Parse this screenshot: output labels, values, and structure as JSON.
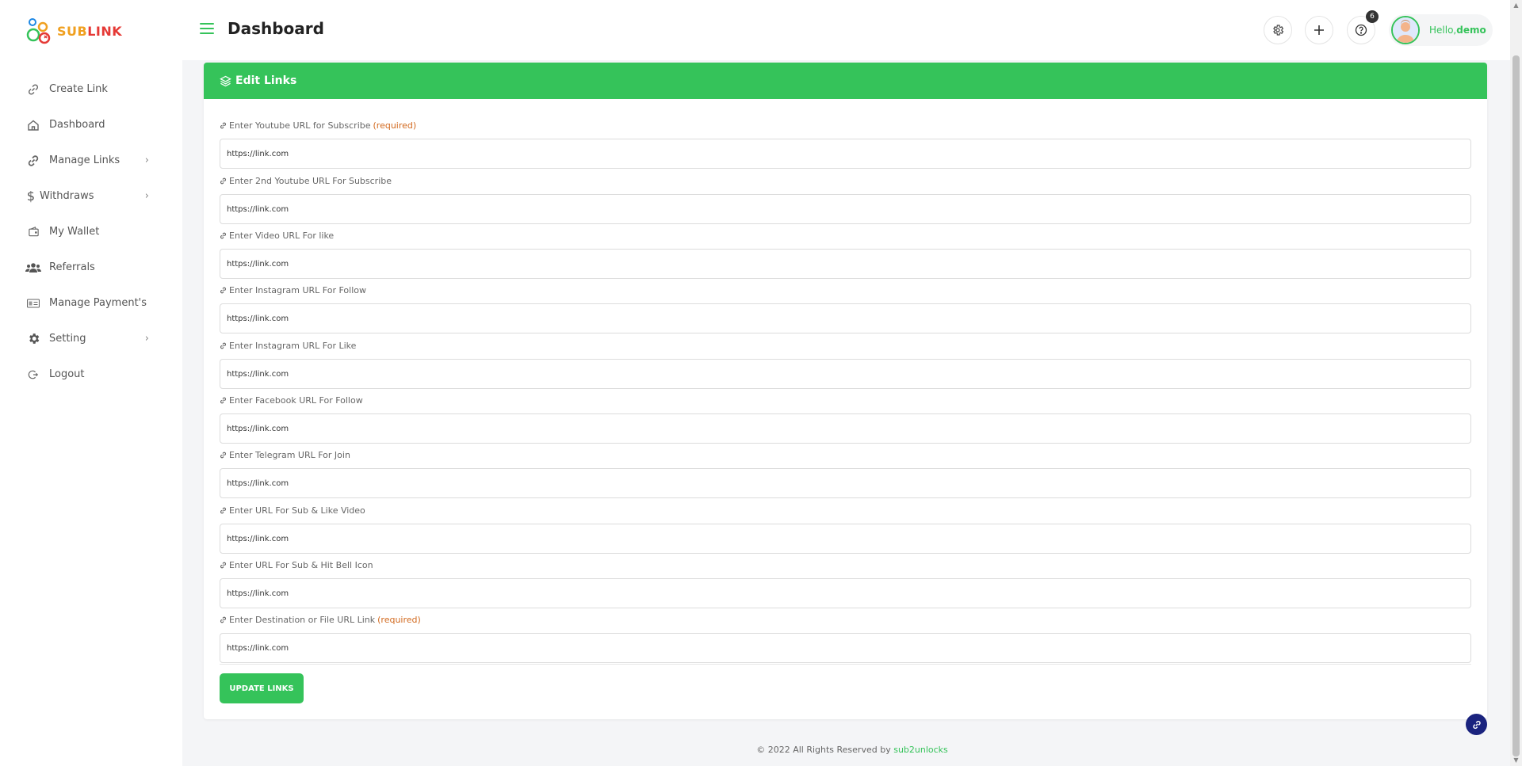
{
  "brand": {
    "logo_part1": "SUB",
    "logo_part2": "LINK",
    "colors": {
      "primary": "#35c35a",
      "logo_orange": "#f0a020",
      "logo_red": "#e53935"
    }
  },
  "sidebar": {
    "items": [
      {
        "label": "Create Link",
        "icon": "link-icon",
        "has_submenu": false
      },
      {
        "label": "Dashboard",
        "icon": "home-icon",
        "has_submenu": false
      },
      {
        "label": "Manage Links",
        "icon": "links-icon",
        "has_submenu": true
      },
      {
        "label": "Withdraws",
        "icon": "dollar-icon",
        "has_submenu": true
      },
      {
        "label": "My Wallet",
        "icon": "wallet-icon",
        "has_submenu": false
      },
      {
        "label": "Referrals",
        "icon": "users-icon",
        "has_submenu": false
      },
      {
        "label": "Manage Payment's",
        "icon": "payment-icon",
        "has_submenu": false
      },
      {
        "label": "Setting",
        "icon": "gear-icon",
        "has_submenu": true
      },
      {
        "label": "Logout",
        "icon": "logout-icon",
        "has_submenu": false
      }
    ],
    "chevron": "›"
  },
  "header": {
    "title": "Dashboard",
    "help_badge": "6",
    "greeting": "Hello,",
    "username": "demo"
  },
  "card": {
    "title": "Edit Links",
    "fields": [
      {
        "label": "Enter Youtube URL for Subscribe",
        "required": "(required)",
        "value": "https://link.com"
      },
      {
        "label": "Enter 2nd Youtube URL For Subscribe",
        "required": "",
        "value": "https://link.com"
      },
      {
        "label": "Enter Video URL For like",
        "required": "",
        "value": "https://link.com"
      },
      {
        "label": "Enter Instagram URL For Follow",
        "required": "",
        "value": "https://link.com"
      },
      {
        "label": "Enter Instagram URL For Like",
        "required": "",
        "value": "https://link.com"
      },
      {
        "label": "Enter Facebook URL For Follow",
        "required": "",
        "value": "https://link.com"
      },
      {
        "label": "Enter Telegram URL For Join",
        "required": "",
        "value": "https://link.com"
      },
      {
        "label": "Enter URL For Sub & Like Video",
        "required": "",
        "value": "https://link.com"
      },
      {
        "label": "Enter URL For Sub & Hit Bell Icon",
        "required": "",
        "value": "https://link.com"
      },
      {
        "label": "Enter Destination or File URL Link",
        "required": "(required)",
        "value": "https://link.com"
      }
    ],
    "submit_label": "UPDATE LINKS"
  },
  "footer": {
    "text": "© 2022 All Rights Reserved by",
    "link": "sub2unlocks"
  }
}
